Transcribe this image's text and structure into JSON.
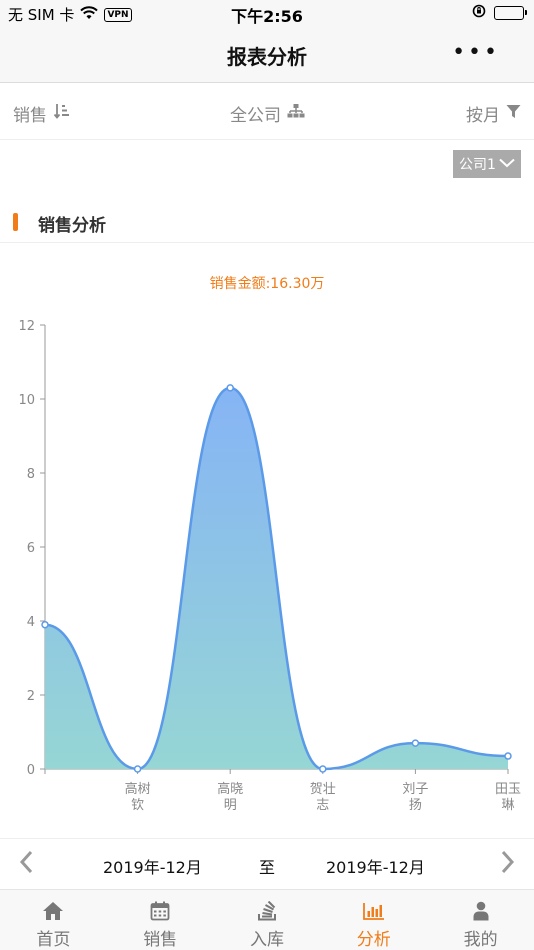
{
  "status_bar": {
    "carrier": "无 SIM 卡",
    "vpn": "VPN",
    "time": "下午2:56"
  },
  "nav": {
    "title": "报表分析"
  },
  "filters": {
    "sort_label": "销售",
    "scope_label": "全公司",
    "period_label": "按月"
  },
  "company_select": {
    "value": "公司1"
  },
  "section": {
    "title": "销售分析"
  },
  "chart_data": {
    "type": "area",
    "title": "销售金额:16.30万",
    "categories": [
      "",
      "高树钦",
      "高晓明",
      "贺壮志",
      "刘子扬",
      "田玉琳"
    ],
    "category_lines": [
      [
        ""
      ],
      [
        "高树",
        "钦"
      ],
      [
        "高晓",
        "明"
      ],
      [
        "贺壮",
        "志"
      ],
      [
        "刘子",
        "扬"
      ],
      [
        "田玉",
        "琳"
      ]
    ],
    "values": [
      3.9,
      0,
      10.3,
      0,
      0.7,
      0.35
    ],
    "ylim": [
      0,
      12
    ],
    "yticks": [
      0,
      2,
      4,
      6,
      8,
      10,
      12
    ],
    "smooth": true,
    "colors": {
      "line": "#5b9ae8",
      "fill_top": "#86b4f5",
      "fill_bottom": "#96d6d4"
    }
  },
  "date_range": {
    "start": "2019年-12月",
    "separator": "至",
    "end": "2019年-12月"
  },
  "tabs": [
    {
      "label": "首页",
      "icon": "home-icon"
    },
    {
      "label": "销售",
      "icon": "calendar-icon"
    },
    {
      "label": "入库",
      "icon": "stack-icon"
    },
    {
      "label": "分析",
      "icon": "bar-chart-icon",
      "active": true
    },
    {
      "label": "我的",
      "icon": "user-icon"
    }
  ],
  "accent_color": "#f07d1a"
}
